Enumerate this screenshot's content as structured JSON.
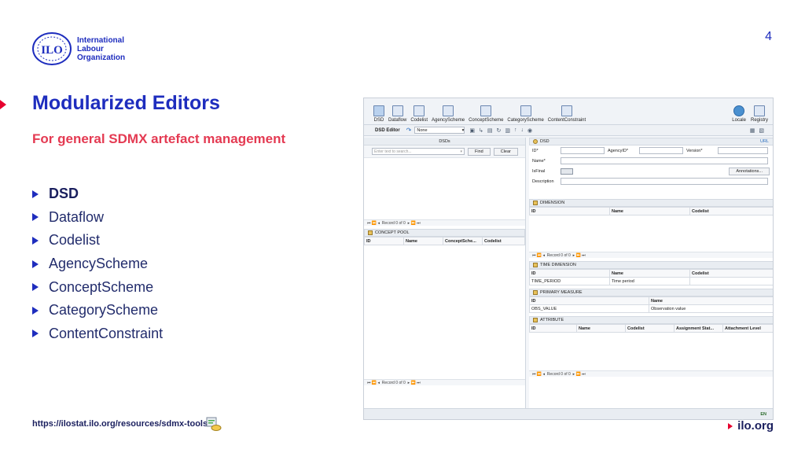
{
  "page_number": "4",
  "logo": {
    "lines": [
      "International",
      "Labour",
      "Organization"
    ],
    "mark_text": "ILO"
  },
  "title": "Modularized Editors",
  "subtitle": "For general SDMX artefact management",
  "bullets": [
    "DSD",
    "Dataflow",
    "Codelist",
    "AgencyScheme",
    "ConceptScheme",
    "CategoryScheme",
    "ContentConstraint"
  ],
  "footer": {
    "link": "https://ilostat.ilo.org/resources/sdmx-tools",
    "site": "ilo.org"
  },
  "app": {
    "ribbon": [
      "DSD",
      "Dataflow",
      "Codelist",
      "AgencyScheme",
      "ConceptScheme",
      "CategoryScheme",
      "ContentConstraint"
    ],
    "ribbon_right": [
      "Locale",
      "Registry"
    ],
    "toolbar": {
      "title": "DSD Editor",
      "select_value": "None"
    },
    "left": {
      "list_title": "DSDs",
      "search_placeholder": "Enter text to search...",
      "find_label": "Find",
      "clear_label": "Clear",
      "pager_top": "Record 0 of 0",
      "concept_pool_title": "CONCEPT POOL",
      "concept_columns": [
        "ID",
        "Name",
        "ConceptSche...",
        "Codelist"
      ],
      "pager_bottom": "Record 0 of 0"
    },
    "right": {
      "dsd_title": "DSD",
      "url_label": "URL",
      "id_label": "ID*",
      "agency_label": "AgencyID*",
      "version_label": "Version*",
      "name_label": "Name*",
      "isfinal_label": "IsFinal",
      "annotations_label": "Annotations...",
      "description_label": "Description",
      "dimension_title": "DIMENSION",
      "dimension_columns": [
        "ID",
        "Name",
        "Codelist"
      ],
      "pager_dimension": "Record 0 of 0",
      "time_dimension_title": "TIME DIMENSION",
      "time_columns": [
        "ID",
        "Name",
        "Codelist"
      ],
      "time_row": [
        "TIME_PERIOD",
        "Time period",
        ""
      ],
      "primary_measure_title": "PRIMARY MEASURE",
      "measure_columns": [
        "ID",
        "Name"
      ],
      "measure_row": [
        "OBS_VALUE",
        "Observation value"
      ],
      "attribute_title": "ATTRIBUTE",
      "attribute_columns": [
        "ID",
        "Name",
        "Codelist",
        "Assignment Stat...",
        "Attachment Level"
      ],
      "pager_attribute": "Record 0 of 0"
    },
    "status": "EN"
  }
}
